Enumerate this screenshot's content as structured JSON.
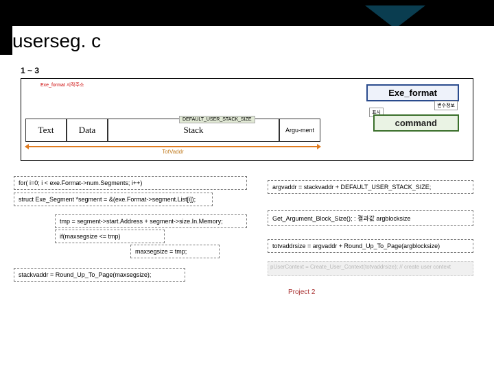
{
  "title": "userseg. c",
  "step": "1 ~ 3",
  "exe_caption": "Exe_format 시작주소",
  "exefmt": "Exe_format",
  "tag_vars": "변수정보",
  "tag_disp": "표시",
  "stack_size_const": "DEFAULT_USER_STACK_SIZE",
  "cmd": "command",
  "mem": {
    "text": "Text",
    "data": "Data",
    "stack": "Stack",
    "arg": "Argu-ment"
  },
  "totvaddr": "TotVaddr",
  "code": {
    "for": "for( i=0; i < exe.Format->num.Segments; i++)",
    "seg": "struct Exe_Segment *segment = &(exe.Format->segment.List[i]);",
    "tmp": "tmp = segment->start.Address + segment->size.In.Memory;",
    "if": "if(maxsegsize <= tmp)",
    "assign": "maxsegsize = tmp;",
    "stack": "stackvaddr = Round_Up_To_Page(maxsegsize);",
    "argv": "argvaddr = stackvaddr + DEFAULT_USER_STACK_SIZE;",
    "getarg": "Get_Argument_Block_Size(); : 결과값 argblocksize",
    "tot": "totvaddrsize = argvaddr + Round_Up_To_Page(argblocksize)",
    "ctx": "pUserContext = Create_User_Context(totvaddrsize); // create user context"
  },
  "proj": "Project 2"
}
